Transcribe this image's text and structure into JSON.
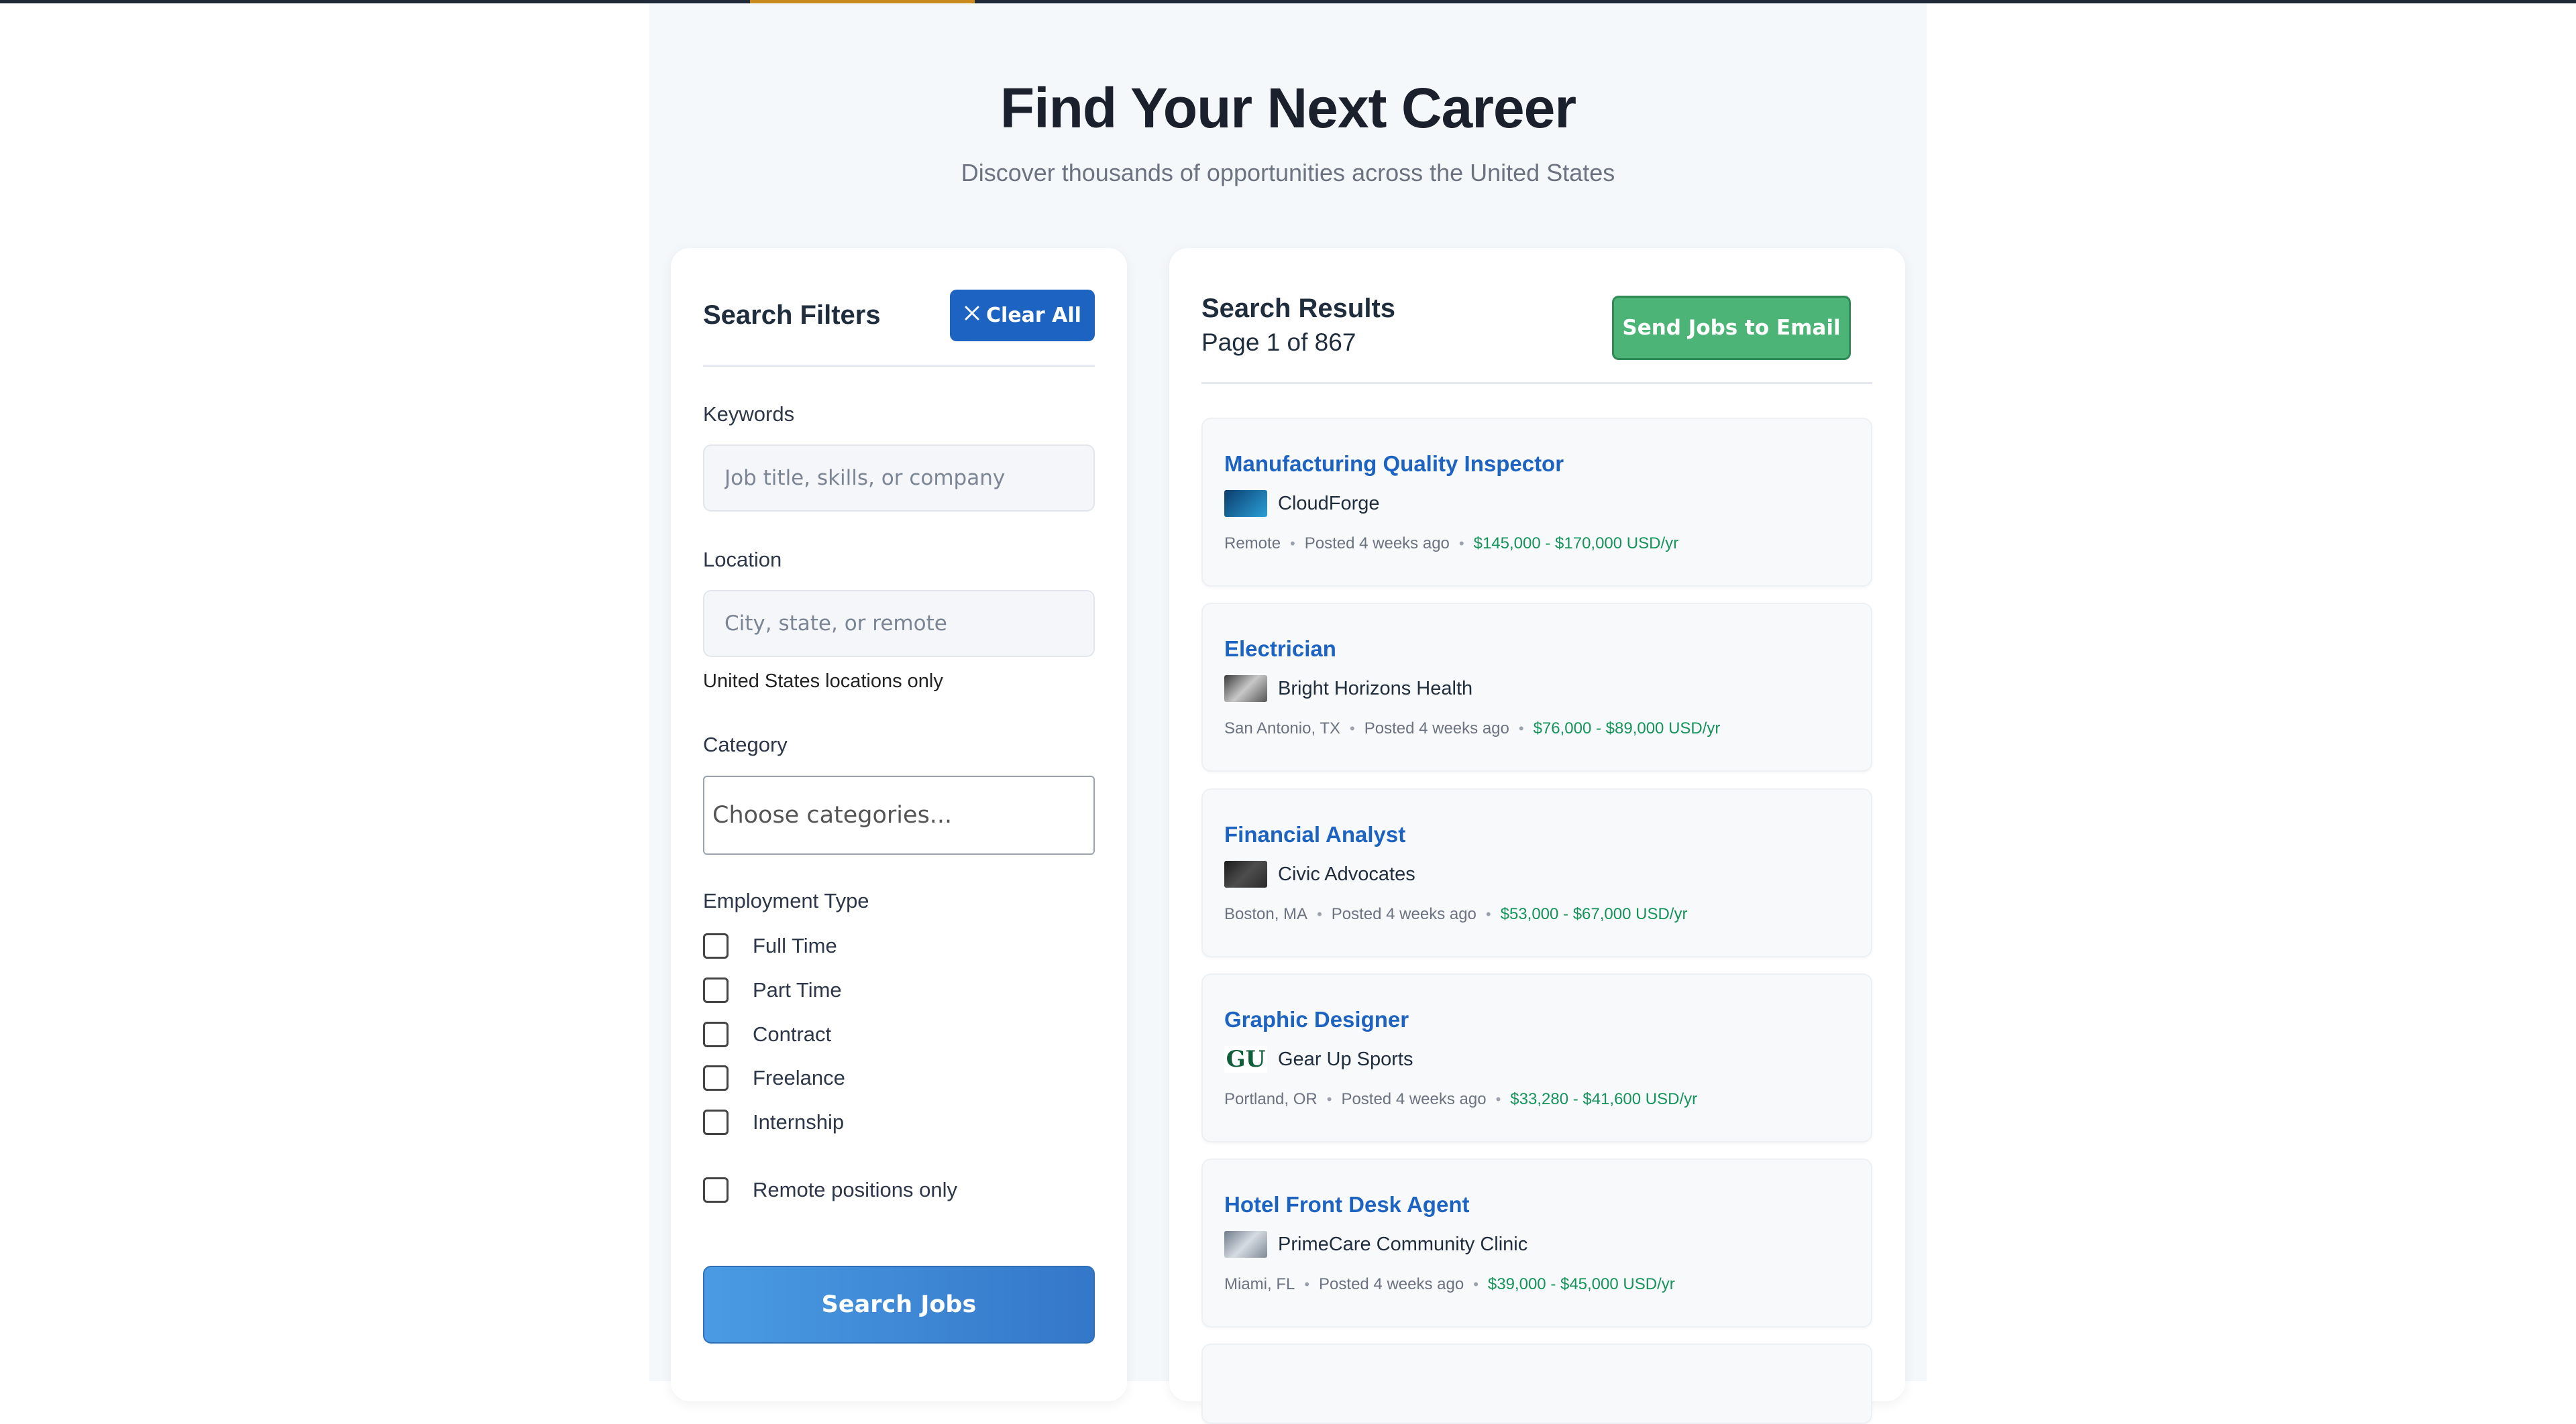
{
  "hero": {
    "title": "Find Your Next Career",
    "subtitle": "Discover thousands of opportunities across the United States"
  },
  "filters": {
    "title": "Search Filters",
    "clear_label": "Clear All",
    "keywords_label": "Keywords",
    "keywords_placeholder": "Job title, skills, or company",
    "keywords_value": "",
    "location_label": "Location",
    "location_placeholder": "City, state, or remote",
    "location_value": "",
    "location_hint": "United States locations only",
    "category_label": "Category",
    "category_placeholder": "Choose categories...",
    "employment_label": "Employment Type",
    "employment_types": [
      "Full Time",
      "Part Time",
      "Contract",
      "Freelance",
      "Internship"
    ],
    "remote_label": "Remote positions only",
    "search_label": "Search Jobs"
  },
  "results": {
    "title": "Search Results",
    "page_info": "Page 1 of 867",
    "email_label": "Send Jobs to Email",
    "jobs": [
      {
        "title": "Manufacturing Quality Inspector",
        "company": "CloudForge",
        "location": "Remote",
        "posted": "Posted 4 weeks ago",
        "salary": "$145,000 - $170,000 USD/yr",
        "logo": "cloudforge-logo"
      },
      {
        "title": "Electrician",
        "company": "Bright Horizons Health",
        "location": "San Antonio, TX",
        "posted": "Posted 4 weeks ago",
        "salary": "$76,000 - $89,000 USD/yr",
        "logo": "bright-horizons-logo"
      },
      {
        "title": "Financial Analyst",
        "company": "Civic Advocates",
        "location": "Boston, MA",
        "posted": "Posted 4 weeks ago",
        "salary": "$53,000 - $67,000 USD/yr",
        "logo": "civic-advocates-logo"
      },
      {
        "title": "Graphic Designer",
        "company": "Gear Up Sports",
        "location": "Portland, OR",
        "posted": "Posted 4 weeks ago",
        "salary": "$33,280 - $41,600 USD/yr",
        "logo": "gear-up-sports-logo"
      },
      {
        "title": "Hotel Front Desk Agent",
        "company": "PrimeCare Community Clinic",
        "location": "Miami, FL",
        "posted": "Posted 4 weeks ago",
        "salary": "$39,000 - $45,000 USD/yr",
        "logo": "primecare-logo"
      }
    ]
  },
  "colors": {
    "accent": "#1d63c1",
    "success": "#4cb477",
    "salary": "#15935a"
  }
}
